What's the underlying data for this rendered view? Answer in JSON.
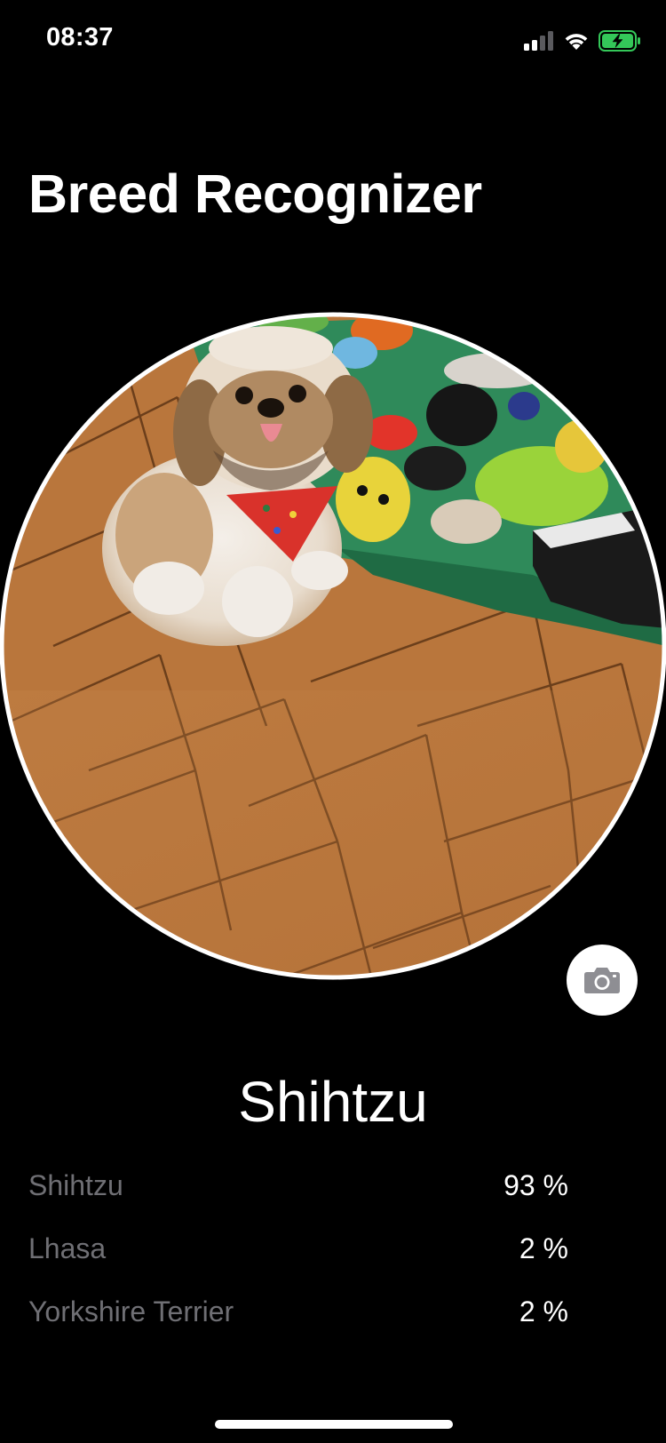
{
  "status_bar": {
    "time": "08:37",
    "signal_icon": "cellular-signal-icon",
    "wifi_icon": "wifi-icon",
    "battery_icon": "battery-charging-icon",
    "battery_color": "#34c759"
  },
  "header": {
    "title": "Breed Recognizer"
  },
  "photo": {
    "border_color": "#ffffff",
    "description_icon": "dog-photo"
  },
  "camera_button": {
    "icon": "camera-icon"
  },
  "result": {
    "top_breed": "Shihtzu",
    "predictions": [
      {
        "label": "Shihtzu",
        "value": "93 %"
      },
      {
        "label": "Lhasa",
        "value": "2 %"
      },
      {
        "label": "Yorkshire Terrier",
        "value": "2 %"
      }
    ]
  },
  "colors": {
    "background": "#000000",
    "label_gray": "#6f6f74",
    "text_white": "#ffffff"
  }
}
